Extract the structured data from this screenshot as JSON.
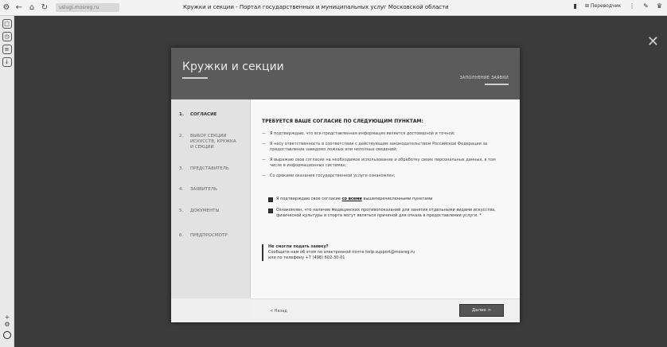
{
  "browser": {
    "address": "uslugi.mosreg.ru",
    "tab_title": "Кружки и секции - Портал государственных и муниципальных услуг Московской области",
    "translate_label": "Переводчик",
    "nav": {
      "back": "←",
      "reload": "↻",
      "shield": "⚙",
      "home": "⌂"
    }
  },
  "modal": {
    "title": "Кружки и секции",
    "header_link": "ЗАПОЛНЕНИЕ ЗАЯВКИ",
    "steps": [
      {
        "num": "1.",
        "label": "СОГЛАСИЕ"
      },
      {
        "num": "2.",
        "label": "ВЫБОР СЕКЦИИ ИСКУССТВ, КРУЖКА И СЕКЦИИ"
      },
      {
        "num": "3.",
        "label": "ПРЕДСТАВИТЕЛЬ"
      },
      {
        "num": "4.",
        "label": "ЗАЯВИТЕЛЬ"
      },
      {
        "num": "5.",
        "label": "ДОКУМЕНТЫ"
      },
      {
        "num": "6.",
        "label": "ПРЕДПРОСМОТР"
      }
    ],
    "content": {
      "heading": "ТРЕБУЕТСЯ ВАШЕ СОГЛАСИЕ ПО СЛЕДУЮЩИМ ПУНКТАМ:",
      "items": [
        "Я подтверждаю, что вся представленная информация является достоверной и точной;",
        "Я несу ответственность в соответствии с действующим законодательством Российской Федерации за предоставление заведомо ложных или неполных сведений;",
        "Я выражаю свое согласие на необходимое использование и обработку своих персональных данных, в том числе в информационных системах;",
        "Со сроками оказания государственной услуги ознакомлен;"
      ],
      "checks": [
        {
          "before": "Я подтверждаю свое согласие ",
          "link": "со всеми",
          "after": " вышеперечисленными пунктами"
        },
        {
          "before": "Ознакомлен, что наличие медицинских противопоказаний для занятия отдельными видами искусства, физической культуры и спорта могут являться причиной для отказа в предоставлении услуги. *",
          "link": "",
          "after": ""
        }
      ],
      "help_lines": [
        "Не смогли подать заявку?",
        "Сообщите нам об этом по электронной почте help.support@mosreg.ru",
        "или по телефону +7 (498) 602-30-01"
      ]
    },
    "back_label": "< Назад",
    "next_label": "Далее >"
  }
}
